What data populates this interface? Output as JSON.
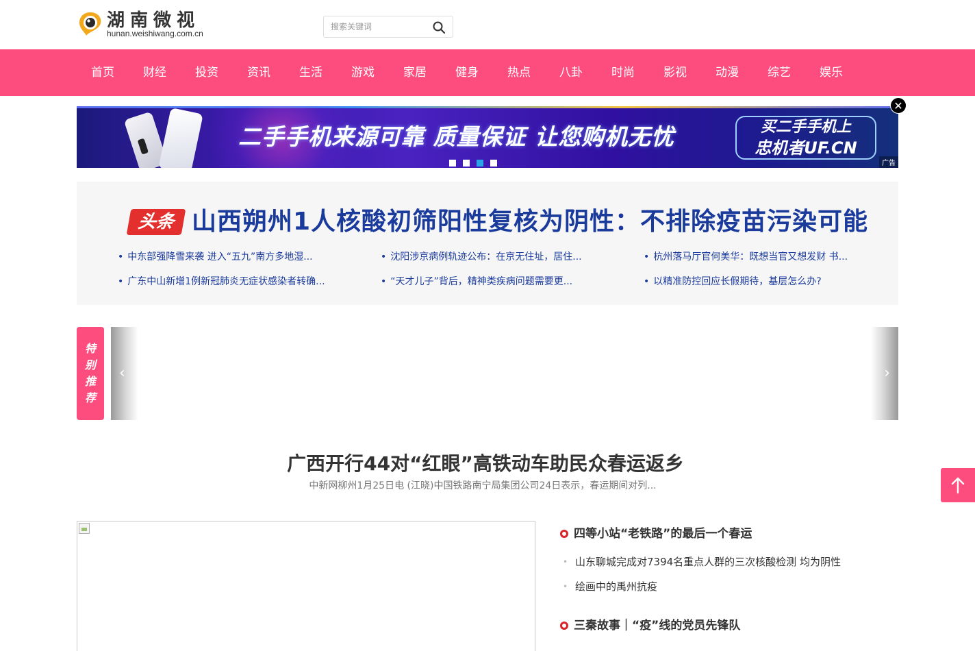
{
  "site": {
    "name_cn": "湖南微视",
    "domain": "hunan.weishiwang.com.cn"
  },
  "search": {
    "placeholder": "搜索关键词"
  },
  "nav": {
    "items": [
      "首页",
      "财经",
      "投资",
      "资讯",
      "生活",
      "游戏",
      "家居",
      "健身",
      "热点",
      "八卦",
      "时尚",
      "影视",
      "动漫",
      "综艺",
      "娱乐"
    ]
  },
  "banner": {
    "text": "二手手机来源可靠 质量保证 让您购机无忧",
    "box_line1": "买二手手机上",
    "box_line2": "忠机者UF.CN",
    "ad_label": "广告",
    "close_symbol": "✕",
    "active_dot": 3
  },
  "headline": {
    "badge": "头条",
    "title": "山西朔州1人核酸初筛阳性复核为阴性：不排除疫苗污染可能",
    "links": [
      "中东部强降雪来袭 进入“五九”南方多地湿...",
      "沈阳涉京病例轨迹公布：在京无住址，居住...",
      "杭州落马厅官何美华：既想当官又想发财 书...",
      "广东中山新增1例新冠肺炎无症状感染者转确...",
      "“天才儿子”背后，精神类疾病问题需要更...",
      "以精准防控回应长假期待，基层怎么办?"
    ]
  },
  "special": {
    "tag": [
      "特",
      "别",
      "推",
      "荐"
    ],
    "prev": "‹",
    "next": "›"
  },
  "story": {
    "title": "广西开行44对“红眼”高铁动车助民众春运返乡",
    "summary": "中新网柳州1月25日电 (江晓)中国铁路南宁局集团公司24日表示，春运期间对列..."
  },
  "news_list": {
    "head1": "四等小站“老铁路”的最后一个春运",
    "sub": [
      "山东聊城完成对7394名重点人群的三次核酸检测 均为阴性",
      "绘画中的禹州抗疫"
    ],
    "head2": "三秦故事｜“疫”线的党员先锋队"
  },
  "colors": {
    "brand_pink": "#fd4d7e",
    "headline_blue": "#1a3a9c",
    "badge_red": "#e3302e",
    "ring_red": "#d8232a"
  }
}
